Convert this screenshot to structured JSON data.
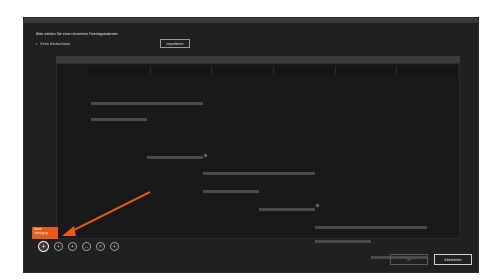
{
  "dialog": {
    "prompt": "Bitte wählen Sie einen einzelnen Feiertagskalender:",
    "provider": "Kerio Deutschland",
    "import_label": "Importieren"
  },
  "timeline": {
    "columns": [
      "",
      "",
      "",
      "",
      "",
      ""
    ]
  },
  "gantt_rows": [
    {
      "label": ""
    },
    {
      "label": ""
    },
    {
      "label": ""
    },
    {
      "label": ""
    },
    {
      "label": ""
    },
    {
      "label": ""
    },
    {
      "label": ""
    }
  ],
  "tooltip": {
    "line1": "Neue",
    "line2": "Leist.grup."
  },
  "toolbar": {
    "buttons": [
      "+",
      "+",
      "+",
      "↔",
      "×",
      "+"
    ]
  },
  "footer": {
    "ok_label": "OK",
    "cancel_label": "Abbrechen"
  },
  "colors": {
    "dialog_bg": "#202020",
    "accent": "#e85b12",
    "arrow": "#e85b12"
  },
  "icons": [
    "chevron-right-icon",
    "add-circle-icon",
    "arrow-icon"
  ]
}
